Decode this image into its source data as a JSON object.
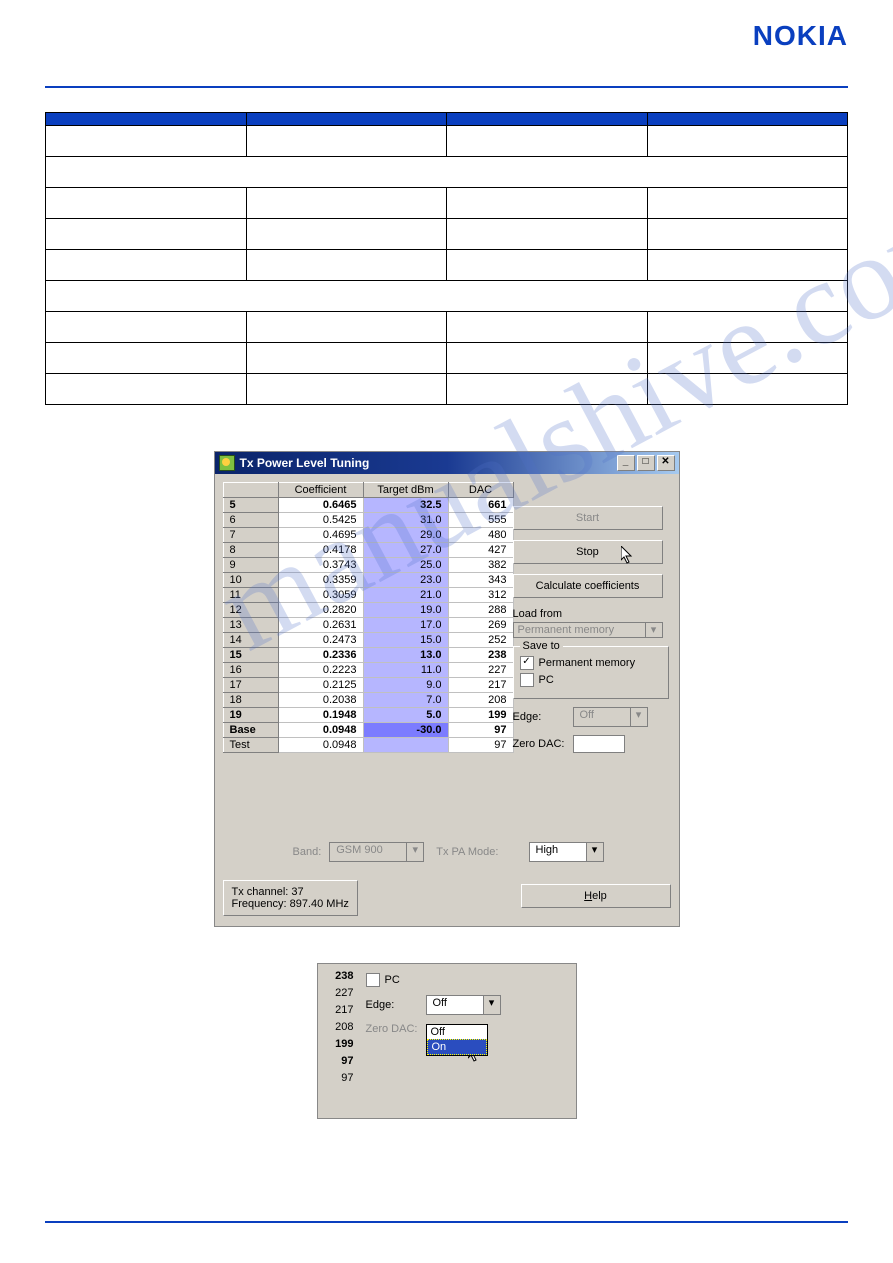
{
  "logo": "NOKIA",
  "outerTable": {
    "headers": [
      "",
      "",
      "",
      ""
    ],
    "rows": [
      [
        "",
        "",
        "",
        ""
      ],
      [
        ""
      ],
      [
        "",
        "",
        "",
        ""
      ],
      [
        "",
        "",
        "",
        ""
      ],
      [
        "",
        "",
        "",
        ""
      ],
      [
        ""
      ],
      [
        "",
        "",
        "",
        ""
      ],
      [
        "",
        "",
        "",
        ""
      ],
      [
        "",
        "",
        "",
        ""
      ]
    ]
  },
  "watermark": "manualshive.com",
  "window": {
    "title": "Tx Power Level Tuning",
    "grid": {
      "headers": [
        "",
        "Coefficient",
        "Target dBm",
        "DAC"
      ],
      "rows": [
        {
          "r": "5",
          "c": "0.6465",
          "t": "32.5",
          "d": "661",
          "bold": true
        },
        {
          "r": "6",
          "c": "0.5425",
          "t": "31.0",
          "d": "555"
        },
        {
          "r": "7",
          "c": "0.4695",
          "t": "29.0",
          "d": "480"
        },
        {
          "r": "8",
          "c": "0.4178",
          "t": "27.0",
          "d": "427"
        },
        {
          "r": "9",
          "c": "0.3743",
          "t": "25.0",
          "d": "382"
        },
        {
          "r": "10",
          "c": "0.3359",
          "t": "23.0",
          "d": "343"
        },
        {
          "r": "11",
          "c": "0.3059",
          "t": "21.0",
          "d": "312"
        },
        {
          "r": "12",
          "c": "0.2820",
          "t": "19.0",
          "d": "288"
        },
        {
          "r": "13",
          "c": "0.2631",
          "t": "17.0",
          "d": "269"
        },
        {
          "r": "14",
          "c": "0.2473",
          "t": "15.0",
          "d": "252"
        },
        {
          "r": "15",
          "c": "0.2336",
          "t": "13.0",
          "d": "238",
          "bold": true
        },
        {
          "r": "16",
          "c": "0.2223",
          "t": "11.0",
          "d": "227"
        },
        {
          "r": "17",
          "c": "0.2125",
          "t": "9.0",
          "d": "217"
        },
        {
          "r": "18",
          "c": "0.2038",
          "t": "7.0",
          "d": "208"
        },
        {
          "r": "19",
          "c": "0.1948",
          "t": "5.0",
          "d": "199",
          "bold": true
        },
        {
          "r": "Base",
          "c": "0.0948",
          "t": "-30.0",
          "d": "97",
          "bold": true,
          "base": true
        },
        {
          "r": "Test",
          "c": "0.0948",
          "t": "",
          "d": "97"
        }
      ]
    },
    "buttons": {
      "start": "Start",
      "stop": "Stop",
      "calc": "Calculate coefficients",
      "help": "Help"
    },
    "load": {
      "label": "Load from",
      "value": "Permanent memory"
    },
    "save": {
      "group": "Save to",
      "perm": "Permanent memory",
      "pc": "PC",
      "permChecked": true,
      "pcChecked": false
    },
    "edge": {
      "label": "Edge:",
      "value": "Off"
    },
    "zero": {
      "label": "Zero DAC:",
      "value": ""
    },
    "band": {
      "label": "Band:",
      "value": "GSM 900"
    },
    "txpa": {
      "label": "Tx PA Mode:",
      "value": "High"
    },
    "info": {
      "line1": "Tx channel: 37",
      "line2": "Frequency:  897.40 MHz"
    }
  },
  "smallPanel": {
    "col": [
      {
        "v": "238",
        "b": true
      },
      {
        "v": "227"
      },
      {
        "v": "217"
      },
      {
        "v": "208"
      },
      {
        "v": "199",
        "b": true
      },
      {
        "v": "97",
        "b": true
      },
      {
        "v": "97"
      }
    ],
    "pc": "PC",
    "edgeLabel": "Edge:",
    "edgeValue": "Off",
    "zeroLabel": "Zero DAC:",
    "options": [
      "Off",
      "On"
    ]
  }
}
